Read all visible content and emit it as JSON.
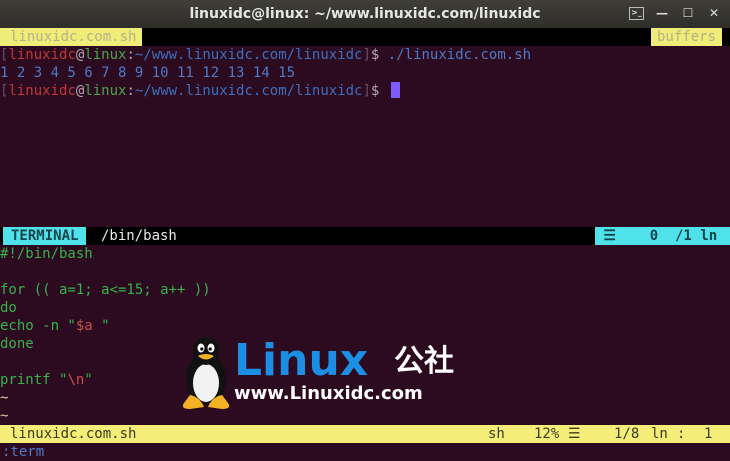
{
  "window": {
    "title": "linuxidc@linux: ~/www.linuxidc.com/linuxidc",
    "controls": {
      "terminal": ">_",
      "minimize": "—",
      "maximize": "☐",
      "close": "✕"
    }
  },
  "tabline": {
    "active_tab": "linuxidc.com.sh",
    "buffers_label": "buffers"
  },
  "terminal": {
    "prompt1": {
      "open": "[",
      "user": "linuxidc",
      "at": "@",
      "host": "linux",
      "colon": ":",
      "path": "~/www.linuxidc.com/linuxidc",
      "close": "]",
      "dollar": "$ ",
      "command": "./linuxidc.com.sh"
    },
    "output": "1 2 3 4 5 6 7 8 9 10 11 12 13 14 15",
    "prompt2": {
      "open": "[",
      "user": "linuxidc",
      "at": "@",
      "host": "linux",
      "colon": ":",
      "path": "~/www.linuxidc.com/linuxidc",
      "close": "]",
      "dollar": "$ "
    }
  },
  "terminal_status": {
    "mode": "TERMINAL",
    "name": "/bin/bash",
    "right": " ☰    0  /1 ln"
  },
  "editor": {
    "lines": [
      "#!/bin/bash",
      "",
      "for (( a=1; a<=15; a++ ))",
      "do",
      "echo -n \"",
      "done",
      "",
      "printf \""
    ],
    "echo_var": "$a",
    "echo_rest": " \"",
    "printf_esc": "\\n",
    "printf_rest": "\"",
    "tilde": "~"
  },
  "editor_status": {
    "filename": "linuxidc.com.sh",
    "filetype": "sh",
    "percent": "12%",
    "lines_icon": "☰",
    "position": "1/8",
    "ln_label": "ln",
    "col_sep": ":",
    "col": "1"
  },
  "cmdline": ":term",
  "watermark": {
    "brand": "Linux",
    "brand_cn": "公社",
    "url": "www.Linuxidc.com"
  }
}
